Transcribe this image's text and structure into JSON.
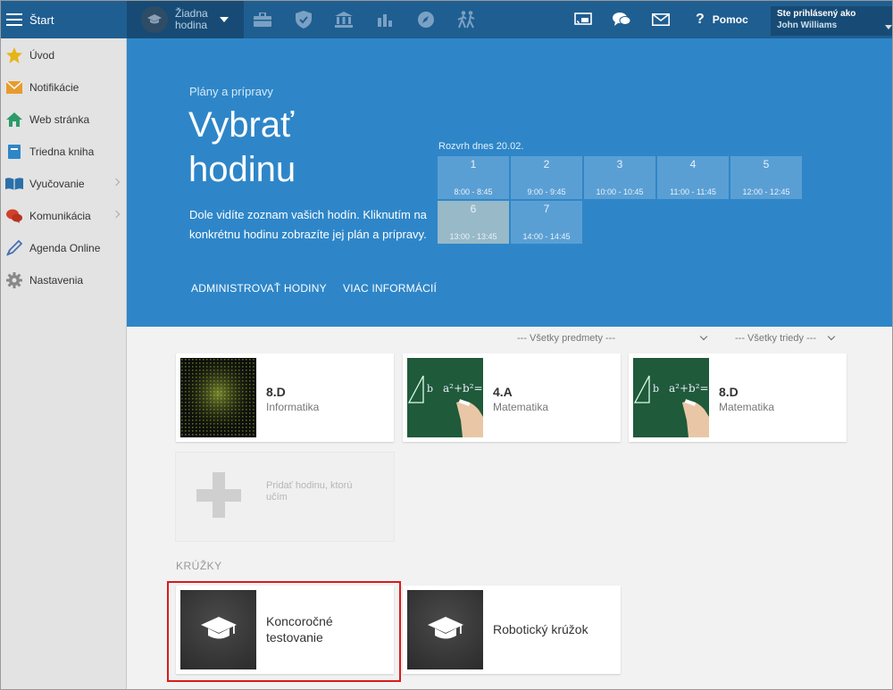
{
  "topbar": {
    "menu_label": "Štart",
    "lesson_selector": {
      "line1": "Žiadna",
      "line2": "hodina"
    },
    "nav_icons": [
      "briefcase-icon",
      "shield-icon",
      "institution-icon",
      "bar-chart-icon",
      "compass-icon",
      "walking-people-icon"
    ],
    "help_label": "Pomoc",
    "user": {
      "signed_in_label": "Ste prihlásený ako",
      "name": "John Williams"
    }
  },
  "sidebar": {
    "items": [
      {
        "label": "Úvod",
        "icon": "star-icon",
        "color": "#e7b416",
        "submenu": false
      },
      {
        "label": "Notifikácie",
        "icon": "envelope-icon",
        "color": "#e89b2c",
        "submenu": false
      },
      {
        "label": "Web stránka",
        "icon": "home-icon",
        "color": "#2b9b6a",
        "submenu": false
      },
      {
        "label": "Triedna kniha",
        "icon": "book-icon",
        "color": "#2e86c8",
        "submenu": false
      },
      {
        "label": "Vyučovanie",
        "icon": "open-book-icon",
        "color": "#2a6fa8",
        "submenu": true
      },
      {
        "label": "Komunikácia",
        "icon": "chat-icon",
        "color": "#d0412d",
        "submenu": true
      },
      {
        "label": "Agenda Online",
        "icon": "pen-icon",
        "color": "#4a6fb5",
        "submenu": false
      },
      {
        "label": "Nastavenia",
        "icon": "gear-icon",
        "color": "#888888",
        "submenu": false
      }
    ]
  },
  "hero": {
    "subtitle": "Plány a prípravy",
    "title_line1": "Vybrať",
    "title_line2": "hodinu",
    "description": "Dole vidíte zoznam vašich hodín. Kliknutím na konkrétnu hodinu zobrazíte jej plán a prípravy.",
    "link_admin": "ADMINISTROVAŤ HODINY",
    "link_more": "VIAC INFORMÁCIÍ"
  },
  "schedule": {
    "title": "Rozvrh dnes 20.02.",
    "slots": [
      {
        "num": "1",
        "time": "8:00 - 8:45"
      },
      {
        "num": "2",
        "time": "9:00 - 9:45"
      },
      {
        "num": "3",
        "time": "10:00 - 10:45"
      },
      {
        "num": "4",
        "time": "11:00 - 11:45"
      },
      {
        "num": "5",
        "time": "12:00 - 12:45"
      },
      {
        "num": "6",
        "time": "13:00 - 13:45"
      },
      {
        "num": "7",
        "time": "14:00 - 14:45"
      }
    ],
    "active_slot": "6"
  },
  "filters": {
    "subjects": "--- Všetky predmety ---",
    "classes": "--- Všetky triedy ---"
  },
  "lessons": [
    {
      "class": "8.D",
      "subject": "Informatika"
    },
    {
      "class": "4.A",
      "subject": "Matematika"
    },
    {
      "class": "8.D",
      "subject": "Matematika"
    }
  ],
  "add_lesson": {
    "line1": "Pridať hodinu, ktorú",
    "line2": "učím"
  },
  "clubs": {
    "heading": "KRÚŽKY",
    "items": [
      {
        "line1": "Koncoročné",
        "line2": "testovanie"
      },
      {
        "line1": "Robotický krúžok"
      }
    ]
  },
  "colors": {
    "topbar": "#1f5e91",
    "hero": "#2e86c8",
    "highlight": "#d81b1b"
  }
}
